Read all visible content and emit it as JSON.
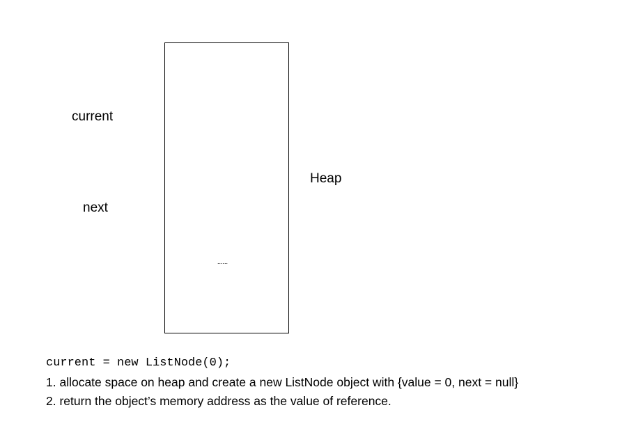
{
  "variables": {
    "current_label": "current",
    "next_label": "next"
  },
  "heap": {
    "label": "Heap",
    "ellipsis": "......"
  },
  "explanation": {
    "code": "current = new ListNode(0);",
    "steps": [
      "1. allocate space on heap and create a new ListNode object with {value = 0, next = null}",
      "2. return the object’s memory address as the value of reference."
    ]
  }
}
